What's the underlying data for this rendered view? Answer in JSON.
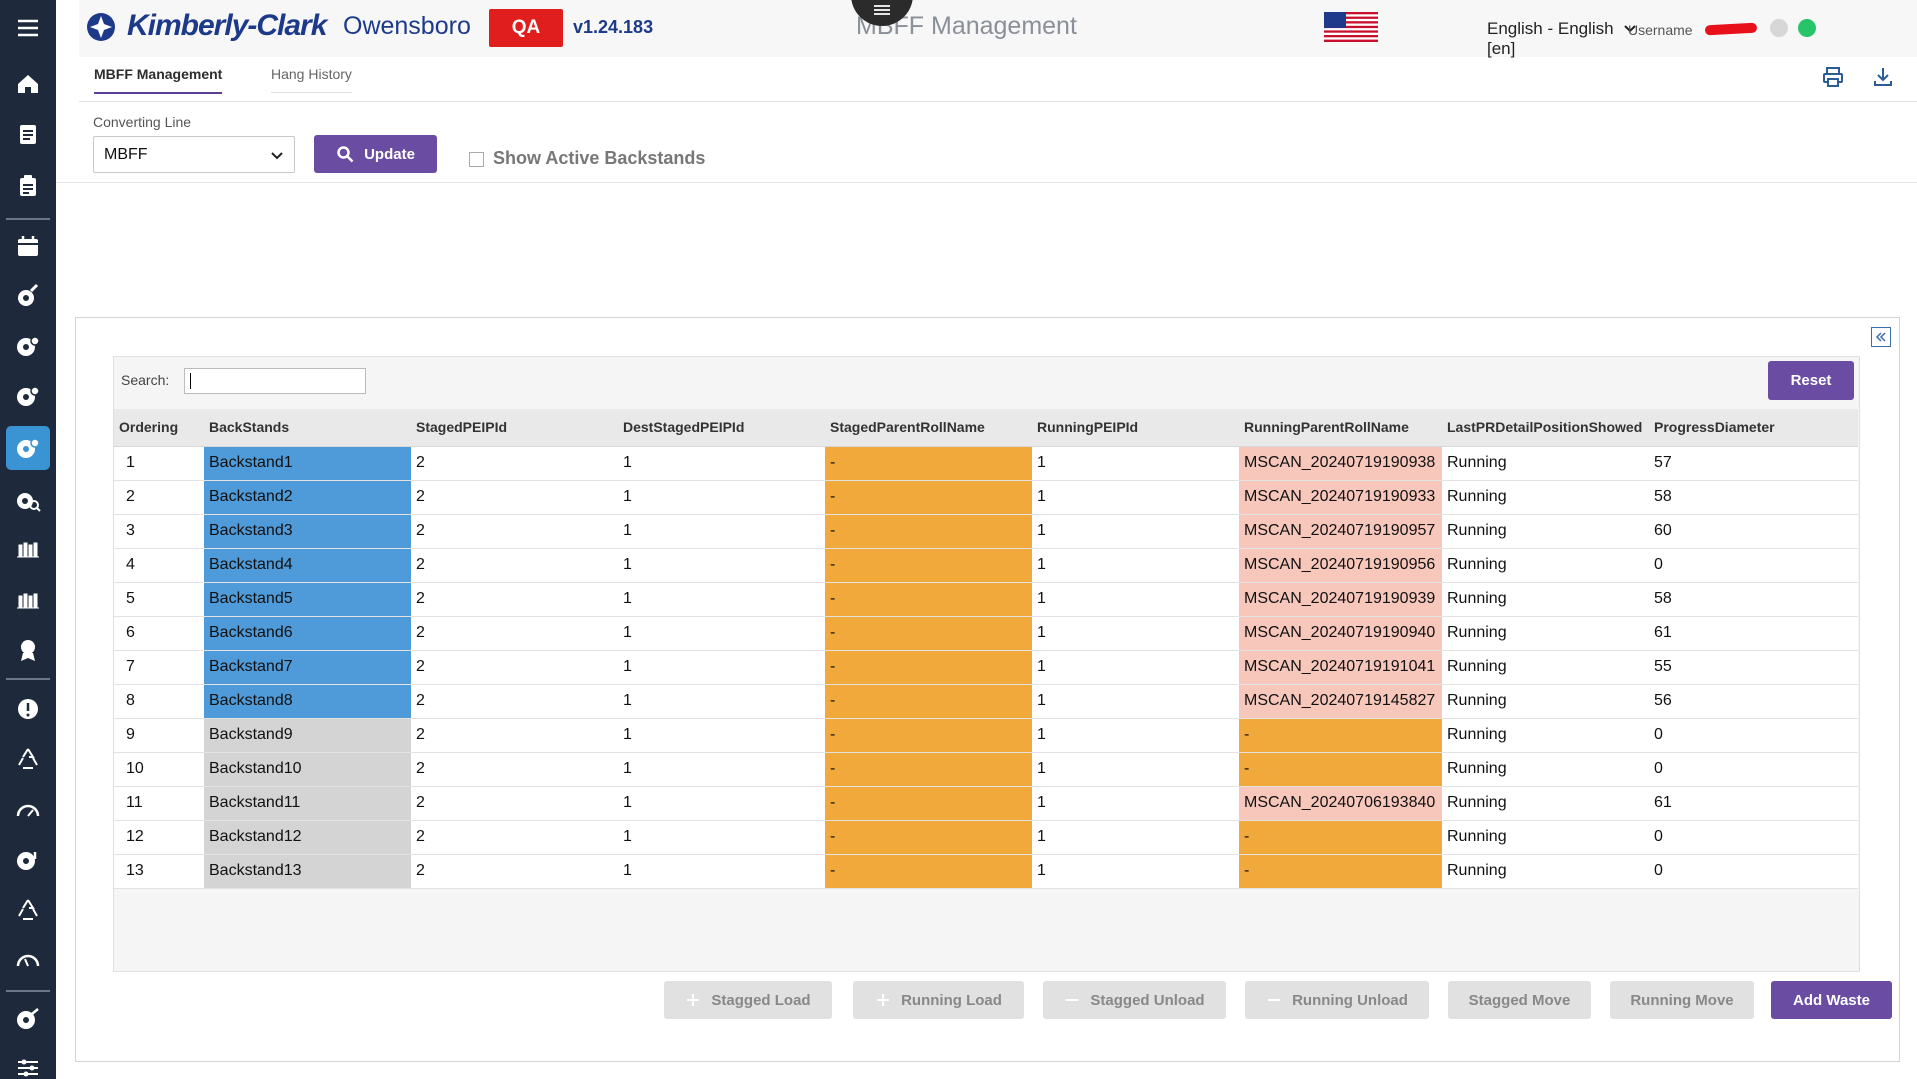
{
  "topbar": {
    "brand": "Kimberly-Clark",
    "site": "Owensboro",
    "env": "QA",
    "version": "v1.24.183",
    "app_title": "MBFF Management",
    "language": "English - English [en]",
    "username_label": "Username"
  },
  "tabs": [
    {
      "label": "MBFF Management",
      "active": true
    },
    {
      "label": "Hang History",
      "active": false
    }
  ],
  "filter": {
    "converting_line_label": "Converting Line",
    "converting_line_value": "MBFF",
    "update_label": "Update",
    "show_active_label": "Show Active Backstands",
    "show_active_checked": false
  },
  "grid": {
    "search_label": "Search:",
    "search_value": "",
    "reset_label": "Reset",
    "columns": [
      "Ordering",
      "BackStands",
      "StagedPEIPId",
      "DestStagedPEIPId",
      "StagedParentRollName",
      "RunningPEIPId",
      "RunningParentRollName",
      "LastPRDetailPositionShowed",
      "ProgressDiameter"
    ],
    "rows": [
      {
        "ordering": "1",
        "backstand": "Backstand1",
        "staged": "2",
        "dest": "1",
        "staged_roll": "-",
        "running": "1",
        "running_roll": "MSCAN_20240719190938",
        "last_pos": "Running",
        "progress": "57",
        "active": true
      },
      {
        "ordering": "2",
        "backstand": "Backstand2",
        "staged": "2",
        "dest": "1",
        "staged_roll": "-",
        "running": "1",
        "running_roll": "MSCAN_20240719190933",
        "last_pos": "Running",
        "progress": "58",
        "active": true
      },
      {
        "ordering": "3",
        "backstand": "Backstand3",
        "staged": "2",
        "dest": "1",
        "staged_roll": "-",
        "running": "1",
        "running_roll": "MSCAN_20240719190957",
        "last_pos": "Running",
        "progress": "60",
        "active": true
      },
      {
        "ordering": "4",
        "backstand": "Backstand4",
        "staged": "2",
        "dest": "1",
        "staged_roll": "-",
        "running": "1",
        "running_roll": "MSCAN_20240719190956",
        "last_pos": "Running",
        "progress": "0",
        "active": true
      },
      {
        "ordering": "5",
        "backstand": "Backstand5",
        "staged": "2",
        "dest": "1",
        "staged_roll": "-",
        "running": "1",
        "running_roll": "MSCAN_20240719190939",
        "last_pos": "Running",
        "progress": "58",
        "active": true
      },
      {
        "ordering": "6",
        "backstand": "Backstand6",
        "staged": "2",
        "dest": "1",
        "staged_roll": "-",
        "running": "1",
        "running_roll": "MSCAN_20240719190940",
        "last_pos": "Running",
        "progress": "61",
        "active": true
      },
      {
        "ordering": "7",
        "backstand": "Backstand7",
        "staged": "2",
        "dest": "1",
        "staged_roll": "-",
        "running": "1",
        "running_roll": "MSCAN_20240719191041",
        "last_pos": "Running",
        "progress": "55",
        "active": true
      },
      {
        "ordering": "8",
        "backstand": "Backstand8",
        "staged": "2",
        "dest": "1",
        "staged_roll": "-",
        "running": "1",
        "running_roll": "MSCAN_20240719145827",
        "last_pos": "Running",
        "progress": "56",
        "active": true
      },
      {
        "ordering": "9",
        "backstand": "Backstand9",
        "staged": "2",
        "dest": "1",
        "staged_roll": "-",
        "running": "1",
        "running_roll": "-",
        "last_pos": "Running",
        "progress": "0",
        "active": false
      },
      {
        "ordering": "10",
        "backstand": "Backstand10",
        "staged": "2",
        "dest": "1",
        "staged_roll": "-",
        "running": "1",
        "running_roll": "-",
        "last_pos": "Running",
        "progress": "0",
        "active": false
      },
      {
        "ordering": "11",
        "backstand": "Backstand11",
        "staged": "2",
        "dest": "1",
        "staged_roll": "-",
        "running": "1",
        "running_roll": "MSCAN_20240706193840",
        "last_pos": "Running",
        "progress": "61",
        "active": false
      },
      {
        "ordering": "12",
        "backstand": "Backstand12",
        "staged": "2",
        "dest": "1",
        "staged_roll": "-",
        "running": "1",
        "running_roll": "-",
        "last_pos": "Running",
        "progress": "0",
        "active": false
      },
      {
        "ordering": "13",
        "backstand": "Backstand13",
        "staged": "2",
        "dest": "1",
        "staged_roll": "-",
        "running": "1",
        "running_roll": "-",
        "last_pos": "Running",
        "progress": "0",
        "active": false
      }
    ]
  },
  "actions": [
    {
      "label": "Stagged Load",
      "icon": "plus-icon",
      "enabled": false
    },
    {
      "label": "Running Load",
      "icon": "plus-icon",
      "enabled": false
    },
    {
      "label": "Stagged Unload",
      "icon": "minus-icon",
      "enabled": false
    },
    {
      "label": "Running Unload",
      "icon": "minus-icon",
      "enabled": false
    },
    {
      "label": "Stagged Move",
      "icon": "",
      "enabled": false
    },
    {
      "label": "Running Move",
      "icon": "",
      "enabled": false
    },
    {
      "label": "Add Waste",
      "icon": "",
      "enabled": true
    }
  ],
  "sidebar_icons": [
    "menu-icon",
    "home-icon",
    "notes-icon",
    "clipboard-icon",
    "calendar-icon",
    "wrench-roll-icon",
    "roll-gear-icon",
    "roll-check-icon",
    "roll-settings-icon",
    "roll-search-icon",
    "warehouse-icon",
    "warehouse-alt-icon",
    "award-icon",
    "alert-icon",
    "recycle-icon",
    "gauge-icon",
    "roll-warning-icon",
    "recycle-alt-icon",
    "speed-icon",
    "roll-edit-icon",
    "sliders-icon"
  ],
  "colors": {
    "sidebar_bg": "#1e2a3c",
    "active_nav": "#3a93d3",
    "primary": "#6a4da3",
    "env_badge": "#e01e1e",
    "backstand_active": "#4f9ad8",
    "backstand_inactive": "#d4d4d4",
    "staged_empty": "#f2a93b",
    "running_roll": "#f7c7bc",
    "online": "#27c46a"
  }
}
